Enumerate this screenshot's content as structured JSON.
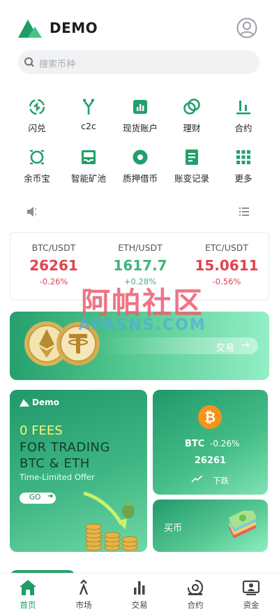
{
  "header": {
    "brand": "DEMO"
  },
  "search": {
    "placeholder": "搜索币种"
  },
  "grid": [
    {
      "label": "闪兑",
      "icon": "flash-exchange-icon"
    },
    {
      "label": "c2c",
      "icon": "c2c-icon"
    },
    {
      "label": "现货账户",
      "icon": "spot-account-icon"
    },
    {
      "label": "理财",
      "icon": "finance-icon"
    },
    {
      "label": "合约",
      "icon": "contract-icon"
    },
    {
      "label": "余币宝",
      "icon": "coin-treasure-icon"
    },
    {
      "label": "智能矿池",
      "icon": "mining-pool-icon"
    },
    {
      "label": "质押借币",
      "icon": "pledge-loan-icon"
    },
    {
      "label": "账变记录",
      "icon": "account-record-icon"
    },
    {
      "label": "更多",
      "icon": "more-grid-icon"
    }
  ],
  "ticker": [
    {
      "pair": "BTC/USDT",
      "price": "26261",
      "change": "-0.26%",
      "direction": "down"
    },
    {
      "pair": "ETH/USDT",
      "price": "1617.7",
      "change": "+0.28%",
      "direction": "up"
    },
    {
      "pair": "ETC/USDT",
      "price": "15.0611",
      "change": "-0.56%",
      "direction": "down"
    }
  ],
  "watermark": {
    "cn": "阿帕社区",
    "en": "APASNS.COM"
  },
  "banner": {
    "button_label": "交易",
    "arrow": "→"
  },
  "promo": {
    "brand": "Demo",
    "fees": "0 FEES",
    "line1": "FOR TRADING",
    "line2": "BTC & ETH",
    "subtitle": "Time-Limited Offer",
    "go_label": "GO",
    "go_arrow": "➜"
  },
  "btc_card": {
    "symbol": "BTC",
    "change": "-0.26%",
    "price": "26261",
    "trend_label": "下跌"
  },
  "buy_card": {
    "label": "买币"
  },
  "tabbar": [
    {
      "label": "首页",
      "active": true
    },
    {
      "label": "市场",
      "active": false
    },
    {
      "label": "交易",
      "active": false
    },
    {
      "label": "合约",
      "active": false
    },
    {
      "label": "资金",
      "active": false
    }
  ],
  "colors": {
    "accent": "#1e9e66",
    "down": "#e0434f",
    "up": "#3fb47d"
  }
}
